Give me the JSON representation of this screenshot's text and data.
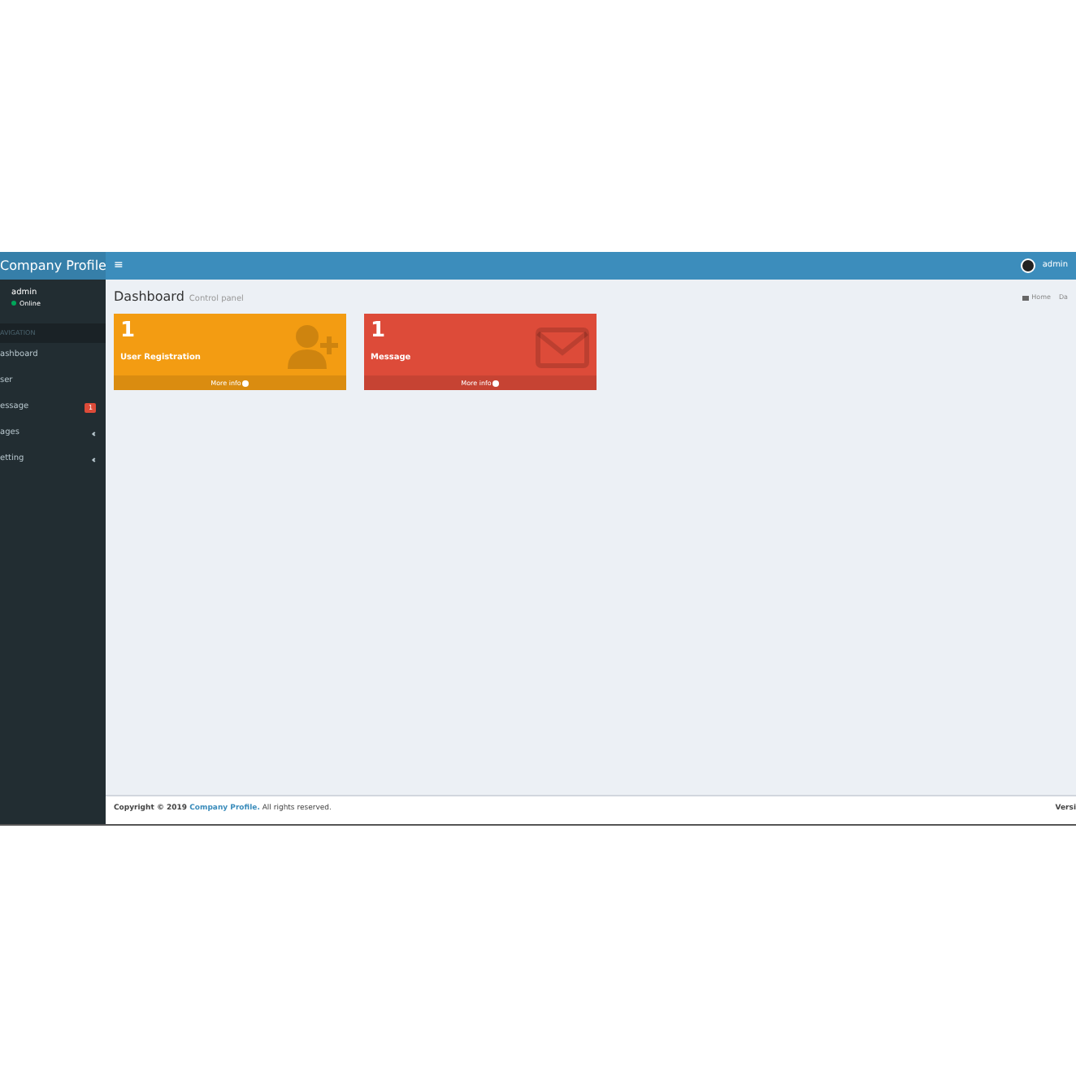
{
  "brand": "Company Profile",
  "user": {
    "name": "admin",
    "status": "Online"
  },
  "sidebar": {
    "header": "AVIGATION",
    "items": [
      {
        "label": "ashboard",
        "kind": "plain"
      },
      {
        "label": "ser",
        "kind": "plain"
      },
      {
        "label": "essage",
        "kind": "badge",
        "badge": "1"
      },
      {
        "label": "ages",
        "kind": "tree"
      },
      {
        "label": "etting",
        "kind": "tree"
      }
    ]
  },
  "topbar": {
    "menu": "≡",
    "user": "admin"
  },
  "page": {
    "title": "Dashboard",
    "subtitle": "Control panel",
    "breadcrumb": [
      "Home",
      "Da"
    ]
  },
  "boxes": [
    {
      "count": "1",
      "label": "User Registration",
      "link": "More info",
      "color": "#f39c12",
      "kind": "user"
    },
    {
      "count": "1",
      "label": "Message",
      "link": "More info",
      "color": "#dd4b39",
      "kind": "mail"
    }
  ],
  "footer": {
    "prefix": "Copyright © 2019 ",
    "link": "Company Profile.",
    "suffix": " All rights reserved.",
    "right": "Versi"
  }
}
